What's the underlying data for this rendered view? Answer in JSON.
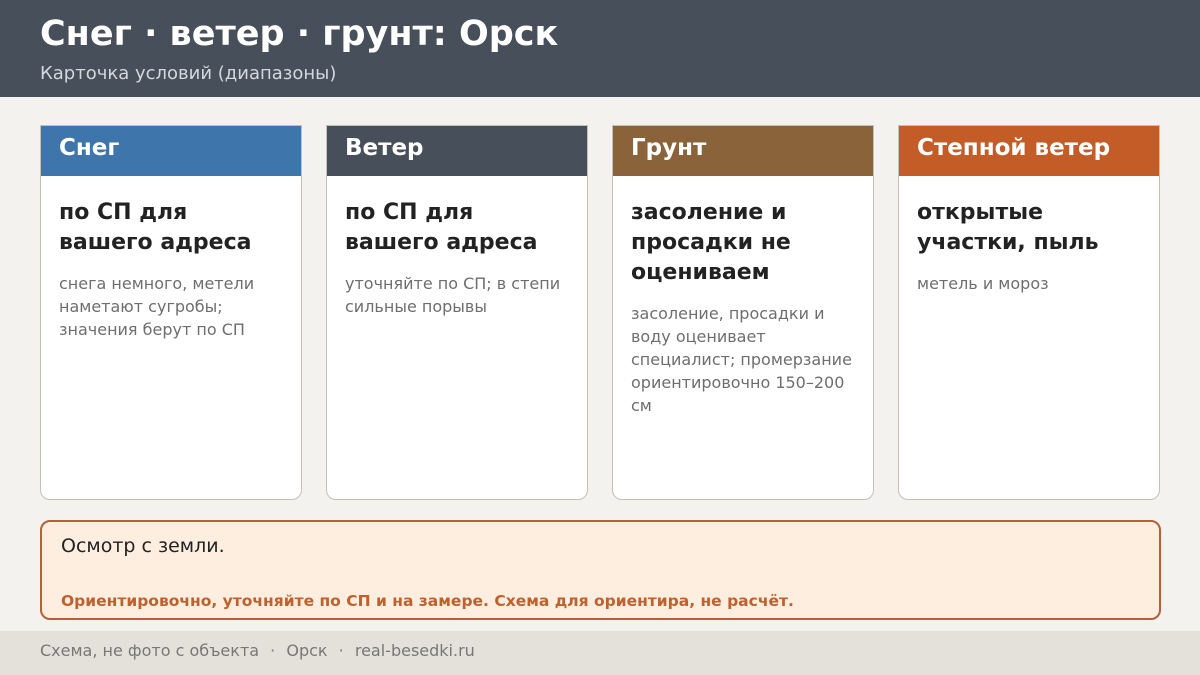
{
  "header": {
    "title": "Снег · ветер · грунт: Орск",
    "subtitle": "Карточка условий (диапазоны)"
  },
  "cards": [
    {
      "label": "Снег",
      "color": "#3e75aa",
      "title": "по СП для вашего адреса",
      "text": "снега немного, метели наметают сугробы; значения берут по СП"
    },
    {
      "label": "Ветер",
      "color": "#474f5a",
      "title": "по СП для вашего адреса",
      "text": "уточняйте по СП; в степи сильные порывы"
    },
    {
      "label": "Грунт",
      "color": "#8b633b",
      "title": "засоление и просадки не оцениваем",
      "text": "засоление, просадки и воду оценивает специалист; промерзание ориентировочно 150–200 см"
    },
    {
      "label": "Степной ветер",
      "color": "#c45c27",
      "title": "открытые участки, пыль",
      "text": "метель и мороз"
    }
  ],
  "note": {
    "title": "Осмотр с земли.",
    "warning": "Ориентировочно, уточняйте по СП и на замере. Схема для ориентира, не расчёт."
  },
  "footer": {
    "left": "Схема, не фото с объекта",
    "separator": "·",
    "city": "Орск",
    "site": "real-besedki.ru"
  }
}
